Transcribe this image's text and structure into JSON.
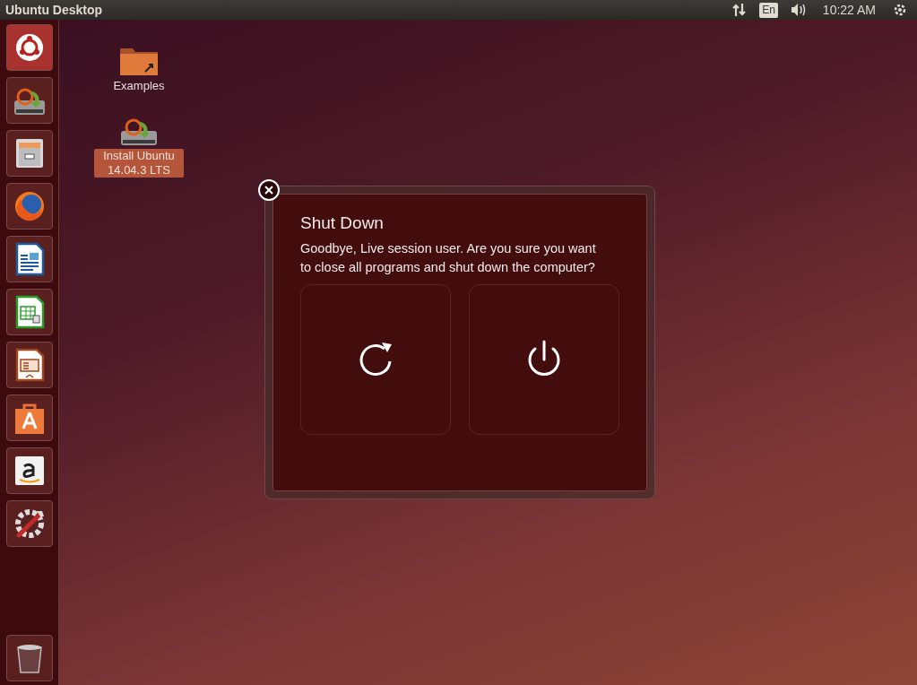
{
  "top_panel": {
    "title": "Ubuntu Desktop",
    "keyboard": "En",
    "clock": "10:22 AM"
  },
  "launcher": [
    {
      "kind": "dash",
      "selected": true
    },
    {
      "kind": "installer",
      "selected": false
    },
    {
      "kind": "files",
      "selected": false
    },
    {
      "kind": "browser",
      "selected": false
    },
    {
      "kind": "writer",
      "selected": false
    },
    {
      "kind": "calc",
      "selected": false
    },
    {
      "kind": "impress",
      "selected": false
    },
    {
      "kind": "software",
      "selected": false
    },
    {
      "kind": "amazon",
      "selected": false
    },
    {
      "kind": "settings",
      "selected": false
    },
    {
      "kind": "trash",
      "selected": false
    }
  ],
  "desktop_icons": [
    {
      "kind": "folder",
      "label": "Examples",
      "selected": false
    },
    {
      "kind": "installer",
      "label": "Install Ubuntu 14.04.3 LTS",
      "selected": true
    }
  ],
  "dialog": {
    "title": "Shut Down",
    "message": "Goodbye, Live session user. Are you sure you want to close all programs and shut down the computer?",
    "buttons": [
      {
        "kind": "restart"
      },
      {
        "kind": "shutdown"
      }
    ]
  }
}
